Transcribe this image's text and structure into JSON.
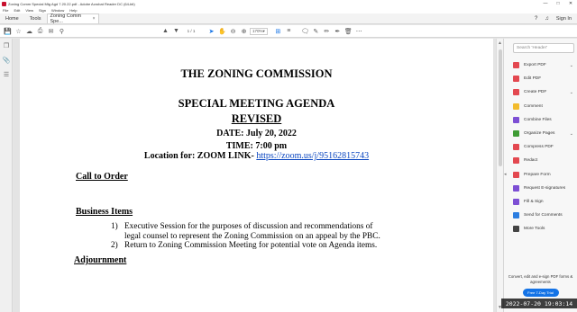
{
  "window": {
    "title": "Zoning Comm Special Mtg Agd 7.20.22.pdf - Adobe Acrobat Reader DC (64-bit)",
    "controls": [
      "—",
      "□",
      "✕"
    ]
  },
  "menubar": [
    "File",
    "Edit",
    "View",
    "Sign",
    "Window",
    "Help"
  ],
  "tabs": {
    "home": "Home",
    "tools": "Tools",
    "document": "Zoning Comm Spe...",
    "close": "×",
    "sign_in": "Sign In",
    "help_icon": "?",
    "bell_icon": "🔔"
  },
  "toolbar": {
    "page_current": "1",
    "page_total": "/ 1",
    "zoom": "170%",
    "zoom_arrow": "▾"
  },
  "document": {
    "heading": "THE ZONING COMMISSION",
    "subheading": "SPECIAL MEETING AGENDA",
    "revised": "REVISED",
    "date": "DATE: July 20, 2022",
    "time": "TIME: 7:00 pm",
    "location_label": "Location for: ZOOM LINK- ",
    "location_link": "https://zoom.us/j/95162815743",
    "call_to_order": "Call to Order ",
    "business_items": "Business Items",
    "items": [
      {
        "num": "1)",
        "text": "Executive Session for the purposes of discussion and recommendations of legal counsel to represent the Zoning Commission on an appeal by the PBC."
      },
      {
        "num": "2)",
        "text": "Return to Zoning Commission Meeting for potential vote on Agenda items."
      }
    ],
    "adjournment": "Adjournment"
  },
  "right_panel": {
    "search_placeholder": "Search 'Header'",
    "tools": [
      {
        "label": "Export PDF",
        "color": "#e34850",
        "chevron": "⌄"
      },
      {
        "label": "Edit PDF",
        "color": "#e34850",
        "chevron": ""
      },
      {
        "label": "Create PDF",
        "color": "#e34850",
        "chevron": "⌄"
      },
      {
        "label": "Comment",
        "color": "#f2bb2c",
        "chevron": ""
      },
      {
        "label": "Combine Files",
        "color": "#7d4fd4",
        "chevron": ""
      },
      {
        "label": "Organize Pages",
        "color": "#3f9c35",
        "chevron": "⌄"
      },
      {
        "label": "Compress PDF",
        "color": "#e34850",
        "chevron": ""
      },
      {
        "label": "Redact",
        "color": "#e34850",
        "chevron": ""
      },
      {
        "label": "Prepare Form",
        "color": "#e34850",
        "chevron": ""
      },
      {
        "label": "Request E-signatures",
        "color": "#7d4fd4",
        "chevron": ""
      },
      {
        "label": "Fill & Sign",
        "color": "#7d4fd4",
        "chevron": ""
      },
      {
        "label": "Send for Comments",
        "color": "#2b7de0",
        "chevron": ""
      },
      {
        "label": "More Tools",
        "color": "#444444",
        "chevron": ""
      }
    ],
    "promo_text": "Convert, edit and e-sign PDF forms & agreements",
    "promo_button": "Free 7-Day Trial"
  },
  "timestamp": "2022-07-20  19:03:14"
}
